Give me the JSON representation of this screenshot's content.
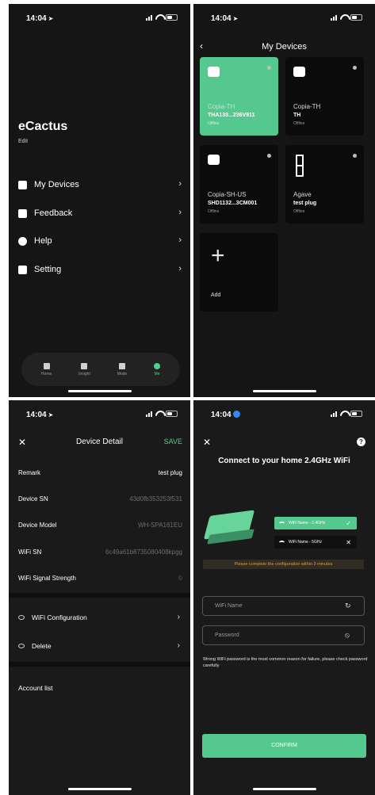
{
  "status": {
    "time": "14:04",
    "time_arrow": "➤"
  },
  "profile": {
    "name": "eCactus",
    "edit": "Edit",
    "menu": [
      {
        "label": "My Devices",
        "icon": "devices-icon"
      },
      {
        "label": "Feedback",
        "icon": "feedback-icon"
      },
      {
        "label": "Help",
        "icon": "help-icon"
      },
      {
        "label": "Setting",
        "icon": "settings-icon"
      }
    ],
    "tabs": [
      {
        "label": "Home",
        "icon": "home-icon"
      },
      {
        "label": "Insight",
        "icon": "insight-icon"
      },
      {
        "label": "Mode",
        "icon": "mode-icon"
      },
      {
        "label": "Me",
        "icon": "me-icon",
        "active": true
      }
    ]
  },
  "devices": {
    "title": "My Devices",
    "cards": [
      {
        "name": "Copia-TH",
        "sub": "THA133...236V911",
        "status": "Offline",
        "icon": "device-icon",
        "highlighted": true
      },
      {
        "name": "Copia-TH",
        "sub": "TH",
        "status": "Offline",
        "icon": "device-icon"
      },
      {
        "name": "Copia-SH-US",
        "sub": "SHD1132...3CM001",
        "status": "Offline",
        "icon": "device-icon"
      },
      {
        "name": "Agave",
        "sub": "test plug",
        "status": "Offline",
        "icon": "plug-icon"
      }
    ],
    "add_label": "Add"
  },
  "device_detail": {
    "title": "Device Detail",
    "save": "SAVE",
    "rows": [
      {
        "label": "Remark",
        "value": "test plug"
      },
      {
        "label": "Device SN",
        "value": "43d0fb353253f531"
      },
      {
        "label": "Device Model",
        "value": "WH-SPA161EU"
      },
      {
        "label": "WiFi SN",
        "value": "6c49a61b8735080408kpgg"
      },
      {
        "label": "WiFi Signal Strength",
        "value": ""
      }
    ],
    "actions": [
      {
        "label": "WiFi Configuration"
      },
      {
        "label": "Delete"
      }
    ],
    "account_list": "Account list"
  },
  "wifi_connect": {
    "title": "Connect to your home 2.4GHz WiFi",
    "options": [
      {
        "label": "WiFi Name - 2.4GHz",
        "mark": "✓"
      },
      {
        "label": "WiFi Name - 5GHz",
        "mark": "✕"
      }
    ],
    "warning": "Please complete the configuration within 3 minutes",
    "wifi_name_placeholder": "WiFi Name",
    "password_placeholder": "Password",
    "note": "Wrong WiFi password is the most common reason for failure, please check password carefully",
    "confirm": "CONFIRM"
  },
  "colors": {
    "accent_green": "#54c88e",
    "warning_text": "#d69b4a",
    "background": "#1a1a1a"
  }
}
